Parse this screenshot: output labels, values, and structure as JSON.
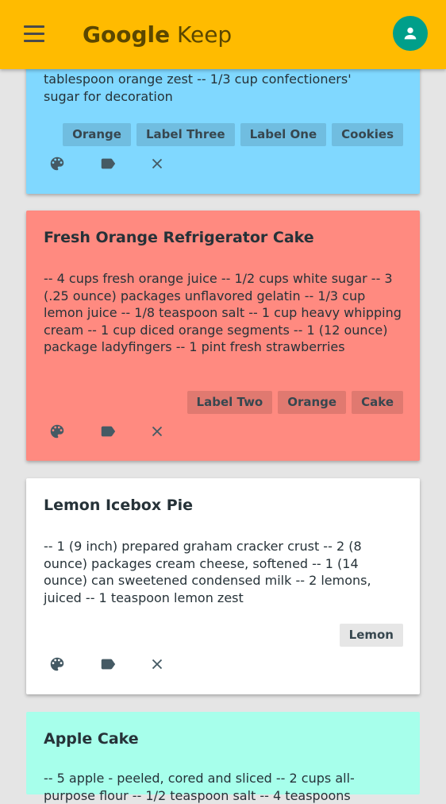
{
  "app": {
    "brand_bold": "Google",
    "brand_light": "Keep"
  },
  "notes": [
    {
      "title": "",
      "body_partial_top": "tablespoon orange zest -- 1/3 cup confectioners'",
      "body_line2": "sugar for decoration",
      "labels": [
        "Orange",
        "Label Three",
        "Label One",
        "Cookies"
      ],
      "color": "#80d8ff"
    },
    {
      "title": "Fresh Orange Refrigerator Cake",
      "body": "-- 4 cups fresh orange juice -- 1/2 cups white sugar -- 3 (.25 ounce) packages unflavored gelatin -- 1/3 cup lemon juice -- 1/8 teaspoon salt -- 1 cup heavy whipping cream -- 1 cup diced orange segments -- 1 (12 ounce) package ladyfingers -- 1 pint fresh strawberries",
      "labels": [
        "Label Two",
        "Orange",
        "Cake"
      ],
      "color": "#ff8a80"
    },
    {
      "title": "Lemon Icebox Pie",
      "body": "-- 1 (9 inch) prepared graham cracker crust -- 2 (8 ounce) packages cream cheese, softened -- 1 (14 ounce) can sweetened condensed milk -- 2 lemons, juiced -- 1 teaspoon lemon zest",
      "labels": [
        "Lemon"
      ],
      "color": "#ffffff"
    },
    {
      "title": "Apple Cake",
      "body": "-- 5 apple - peeled, cored and sliced -- 2 cups all-purpose flour -- 1/2 teaspoon salt -- 4 teaspoons",
      "labels": [],
      "color": "#a7ffeb"
    }
  ],
  "icons": {
    "menu": "menu-icon",
    "avatar": "person-icon",
    "palette": "palette-icon",
    "label": "label-icon",
    "delete": "close-icon"
  },
  "colors": {
    "appbar": "#ffbb00",
    "avatar": "#009f8a",
    "background": "#e5e5e5"
  }
}
